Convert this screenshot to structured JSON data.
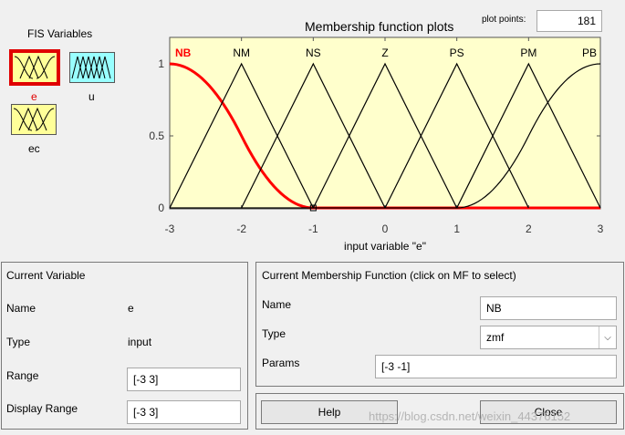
{
  "fis_variables": {
    "title": "FIS Variables",
    "inputs": [
      {
        "name": "e",
        "color": "#ffff99",
        "selected": true,
        "icon": "zmf-mf-icon"
      },
      {
        "name": "ec",
        "color": "#ffff99",
        "selected": false,
        "icon": "zmf-mf-icon"
      }
    ],
    "outputs": [
      {
        "name": "u",
        "color": "#99ffff",
        "selected": false,
        "icon": "trimf-mf-icon"
      }
    ]
  },
  "plot": {
    "title": "Membership function plots",
    "plot_points_label": "plot points:",
    "plot_points_value": "181",
    "xlabel": "input variable \"e\"",
    "x_ticks": [
      "-3",
      "-2",
      "-1",
      "0",
      "1",
      "2",
      "3"
    ],
    "y_ticks": [
      "0",
      "0.5",
      "1"
    ],
    "background": "#ffffcc",
    "selected_color": "#ff0000"
  },
  "chart_data": {
    "type": "line",
    "xlabel": "input variable \"e\"",
    "xlim": [
      -3,
      3
    ],
    "ylim": [
      0,
      1
    ],
    "series": [
      {
        "name": "NB",
        "shape": "zmf",
        "params": [
          -3,
          -1
        ],
        "points": [
          [
            -3,
            1
          ],
          [
            -2.5,
            0.875
          ],
          [
            -2,
            0.5
          ],
          [
            -1.5,
            0.125
          ],
          [
            -1,
            0
          ],
          [
            3,
            0
          ]
        ]
      },
      {
        "name": "NM",
        "shape": "trimf",
        "points": [
          [
            -3,
            0
          ],
          [
            -2,
            1
          ],
          [
            -1,
            0
          ]
        ]
      },
      {
        "name": "NS",
        "shape": "trimf",
        "points": [
          [
            -2,
            0
          ],
          [
            -1,
            1
          ],
          [
            0,
            0
          ]
        ]
      },
      {
        "name": "Z",
        "shape": "trimf",
        "points": [
          [
            -1,
            0
          ],
          [
            0,
            1
          ],
          [
            1,
            0
          ]
        ]
      },
      {
        "name": "PS",
        "shape": "trimf",
        "points": [
          [
            0,
            0
          ],
          [
            1,
            1
          ],
          [
            2,
            0
          ]
        ]
      },
      {
        "name": "PM",
        "shape": "trimf",
        "points": [
          [
            1,
            0
          ],
          [
            2,
            1
          ],
          [
            3,
            0
          ]
        ]
      },
      {
        "name": "PB",
        "shape": "smf",
        "params": [
          1,
          3
        ],
        "points": [
          [
            -3,
            0
          ],
          [
            1,
            0
          ],
          [
            1.5,
            0.125
          ],
          [
            2,
            0.5
          ],
          [
            2.5,
            0.875
          ],
          [
            3,
            1
          ]
        ]
      }
    ]
  },
  "current_variable": {
    "title": "Current Variable",
    "name_label": "Name",
    "name_value": "e",
    "type_label": "Type",
    "type_value": "input",
    "range_label": "Range",
    "range_value": "[-3 3]",
    "display_range_label": "Display Range",
    "display_range_value": "[-3 3]"
  },
  "current_mf": {
    "title": "Current Membership Function (click on MF to select)",
    "name_label": "Name",
    "name_value": "NB",
    "type_label": "Type",
    "type_value": "zmf",
    "params_label": "Params",
    "params_value": "[-3 -1]"
  },
  "buttons": {
    "help": "Help",
    "close": "Close"
  },
  "watermark": "https://blog.csdn.net/weixin_44376152"
}
